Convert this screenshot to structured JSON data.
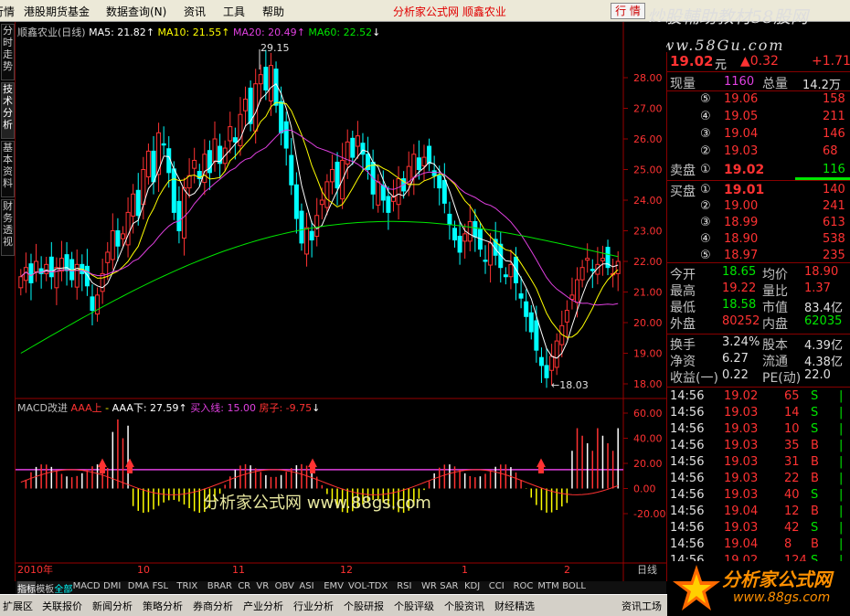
{
  "menubar": {
    "items": [
      "行情",
      "港股期货基金",
      "数据查询(N)",
      "资讯",
      "工具",
      "帮助"
    ],
    "brand_title": "分析家公式网  顺鑫农业",
    "close_label": "行 情",
    "watermark": "炒股輔助教材58股网",
    "watermark_url": "www.58Gu.com"
  },
  "left_tabs": [
    "分时走势",
    "技术分析",
    "基本资料",
    "财务透视"
  ],
  "main_legend": {
    "name": "顺鑫农业(日线)",
    "ma5": "MA5: 21.82",
    "ma10": "MA10: 21.55",
    "ma20": "MA20: 20.49",
    "ma60": "MA60: 22.52"
  },
  "annotations": {
    "high": "29.15",
    "low": "18.03"
  },
  "price_axis": [
    "28.00",
    "27.00",
    "26.00",
    "25.00",
    "24.00",
    "23.00",
    "22.00",
    "21.00",
    "20.00",
    "19.00",
    "18.00"
  ],
  "macd_legend": {
    "name": "MACD改进",
    "aaa_up": "AAA上",
    "aaa_down": "AAA下: 27.59",
    "buy": "买入线: 15.00",
    "house": "房子: -9.75"
  },
  "macd_axis": [
    "60.00",
    "40.00",
    "20.00",
    "0.00",
    "-20.00"
  ],
  "date_axis": [
    "2010年",
    "10",
    "11",
    "12",
    "1",
    "2"
  ],
  "center_watermark": "分析家公式网  www.88gs.com",
  "period_label": "日线",
  "quote": {
    "price": "19.02",
    "unit": "元",
    "change": "▲0.32",
    "change_pct": "+1.71",
    "volume_label": "现量",
    "volume": "1160",
    "total_label": "总量",
    "total": "14.2万",
    "asks": [
      {
        "lvl": "⑤",
        "price": "19.06",
        "vol": "158"
      },
      {
        "lvl": "④",
        "price": "19.05",
        "vol": "211"
      },
      {
        "lvl": "③",
        "price": "19.04",
        "vol": "146"
      },
      {
        "lvl": "②",
        "price": "19.03",
        "vol": "68"
      },
      {
        "lvl": "①",
        "price": "19.02",
        "vol": "116"
      }
    ],
    "ask_label": "卖盘",
    "bid_label": "买盘",
    "bids": [
      {
        "lvl": "①",
        "price": "19.01",
        "vol": "140"
      },
      {
        "lvl": "②",
        "price": "19.00",
        "vol": "241"
      },
      {
        "lvl": "③",
        "price": "18.99",
        "vol": "613"
      },
      {
        "lvl": "④",
        "price": "18.90",
        "vol": "538"
      },
      {
        "lvl": "⑤",
        "price": "18.97",
        "vol": "235"
      }
    ],
    "stats": [
      {
        "l1": "今开",
        "v1": "18.65",
        "c1": "grn",
        "l2": "均价",
        "v2": "18.90",
        "c2": "red"
      },
      {
        "l1": "最高",
        "v1": "19.22",
        "c1": "red",
        "l2": "量比",
        "v2": "1.37",
        "c2": "red"
      },
      {
        "l1": "最低",
        "v1": "18.58",
        "c1": "grn",
        "l2": "市值",
        "v2": "83.4亿",
        "c2": "wht"
      },
      {
        "l1": "外盘",
        "v1": "80252",
        "c1": "red",
        "l2": "内盘",
        "v2": "62035",
        "c2": "grn"
      }
    ],
    "stats2": [
      {
        "l1": "换手",
        "v1": "3.24%",
        "l2": "股本",
        "v2": "4.39亿"
      },
      {
        "l1": "净资",
        "v1": "6.27",
        "l2": "流通",
        "v2": "4.38亿"
      },
      {
        "l1": "收益(一)",
        "v1": "0.22",
        "l2": "PE(动)",
        "v2": "22.0"
      }
    ],
    "ticks": [
      {
        "t": "14:56",
        "p": "19.02",
        "v": "65",
        "s": "S"
      },
      {
        "t": "14:56",
        "p": "19.03",
        "v": "14",
        "s": "S"
      },
      {
        "t": "14:56",
        "p": "19.03",
        "v": "10",
        "s": "S"
      },
      {
        "t": "14:56",
        "p": "19.03",
        "v": "35",
        "s": "B"
      },
      {
        "t": "14:56",
        "p": "19.03",
        "v": "31",
        "s": "B"
      },
      {
        "t": "14:56",
        "p": "19.03",
        "v": "22",
        "s": "B"
      },
      {
        "t": "14:56",
        "p": "19.03",
        "v": "40",
        "s": "S"
      },
      {
        "t": "14:56",
        "p": "19.04",
        "v": "12",
        "s": "B"
      },
      {
        "t": "14:56",
        "p": "19.03",
        "v": "42",
        "s": "S"
      },
      {
        "t": "14:56",
        "p": "19.04",
        "v": "8",
        "s": "B"
      },
      {
        "t": "14:56",
        "p": "19.02",
        "v": "124",
        "s": "S"
      }
    ]
  },
  "bottom_tabs": [
    "指标",
    "模板",
    "全部",
    "MACD",
    "DMI",
    "DMA",
    "FSL",
    "TRIX",
    "BRAR",
    "CR",
    "VR",
    "OBV",
    "ASI",
    "EMV",
    "VOL-TDX",
    "RSI",
    "WR",
    "SAR",
    "KDJ",
    "CCI",
    "ROC",
    "MTM",
    "BOLL"
  ],
  "status_tabs": [
    "扩展区",
    "关联报价",
    "新闻分析",
    "策略分析",
    "券商分析",
    "产业分析",
    "行业分析",
    "个股研报",
    "个股评级",
    "个股资讯",
    "财经精选",
    "资讯工场"
  ],
  "logo": {
    "text": "分析家公式网",
    "url": "www.88gs.com"
  },
  "colors": {
    "up": "#ff3232",
    "down": "#00ffff",
    "ma5": "#ffffff",
    "ma10": "#ffff00",
    "ma20": "#e040e0",
    "ma60": "#00e600",
    "bg": "#000000"
  }
}
